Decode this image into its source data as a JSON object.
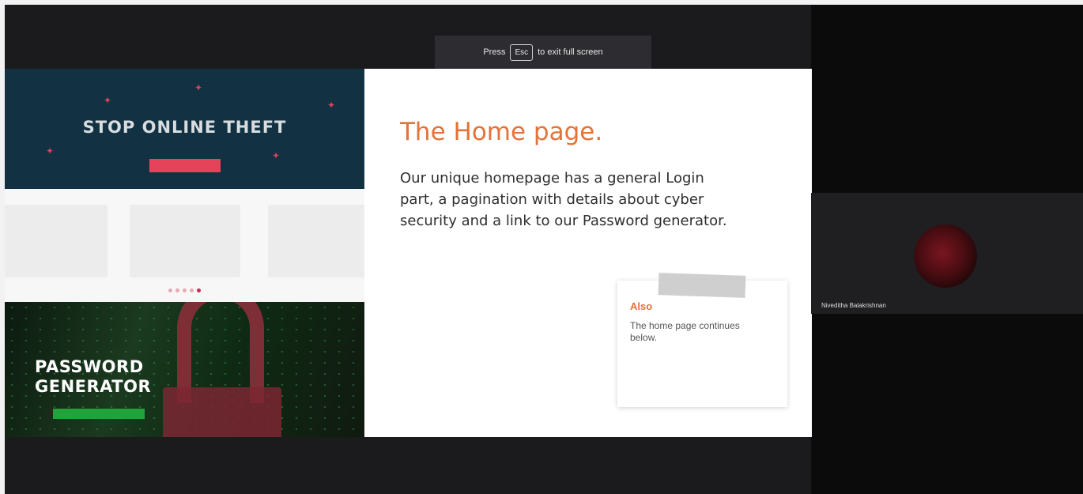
{
  "fullscreen": {
    "press": "Press",
    "key": "Esc",
    "suffix": "to exit full screen"
  },
  "slide": {
    "hero": {
      "title": "STOP ONLINE THEFT",
      "subtitle": "",
      "button": ""
    },
    "cards": [
      {
        "text": ""
      },
      {
        "text": ""
      },
      {
        "text": ""
      }
    ],
    "pagination": {
      "count": 5,
      "active": 4
    },
    "password": {
      "small_text": "",
      "title_line1": "PASSWORD",
      "title_line2": "GENERATOR",
      "button": ""
    },
    "heading": "The Home page.",
    "body": "Our unique homepage has a general Login part, a pagination with details about cyber security and a link to our Password generator.",
    "note": {
      "title": "Also",
      "body": "The home page continues below."
    }
  },
  "participant": {
    "name": "Niveditha Balakrishnan"
  },
  "colors": {
    "accent_orange": "#e2733a",
    "hero_bg": "#123243",
    "hero_button": "#e6435a",
    "password_button": "#1fa33a"
  }
}
